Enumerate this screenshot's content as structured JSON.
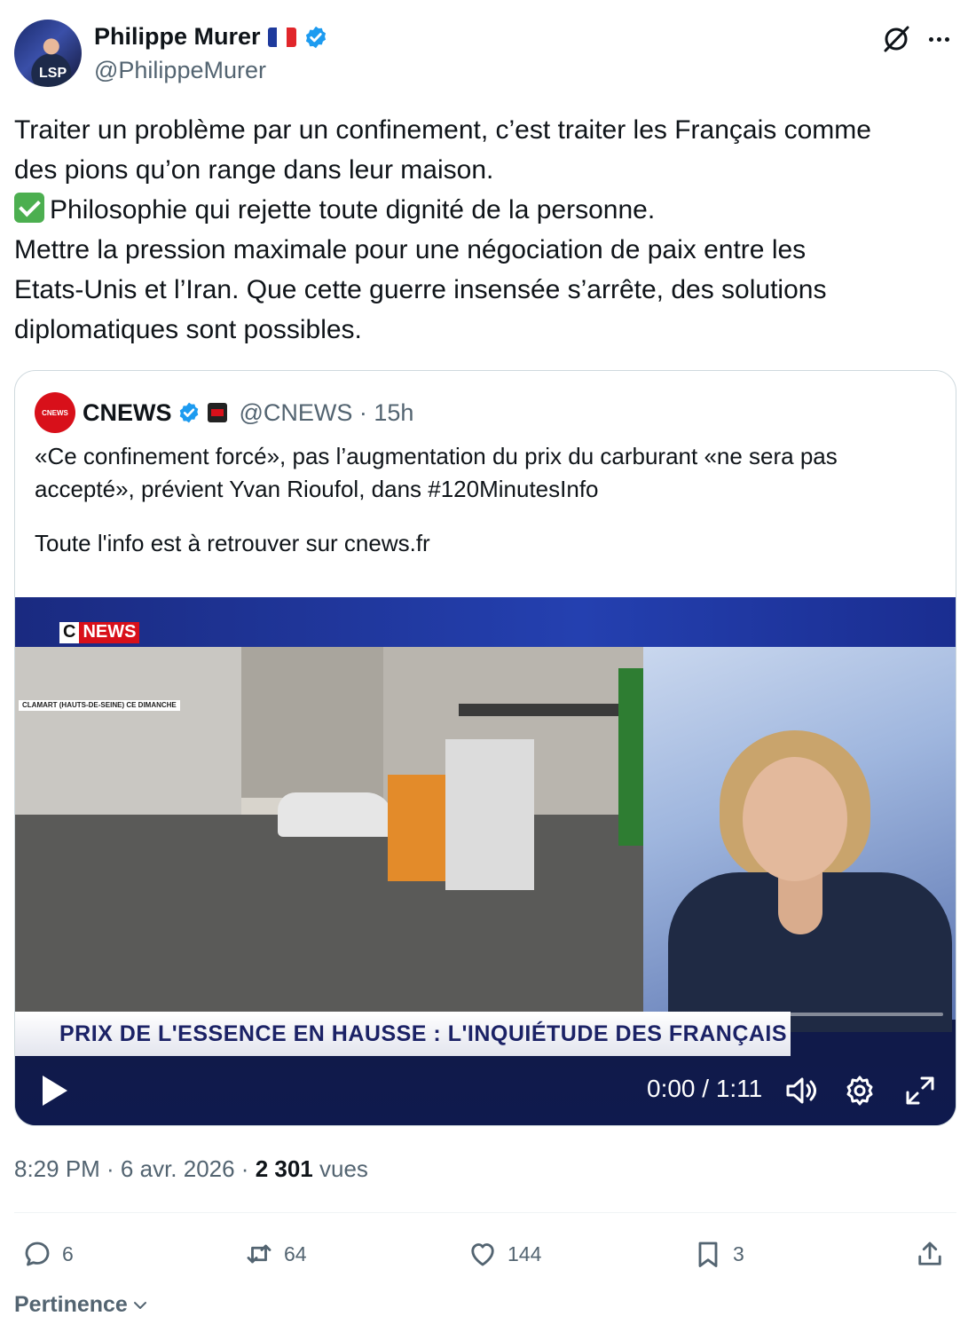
{
  "author": {
    "name": "Philippe Murer",
    "handle": "@PhilippeMurer",
    "avatar_mark": "LSP"
  },
  "tweet": {
    "lines": [
      "Traiter un problème par un confinement, c’est traiter les Français comme",
      "des pions qu’on range dans leur maison.",
      "Philosophie qui rejette toute dignité de la personne.",
      "Mettre la pression maximale pour une négociation de paix entre les",
      "Etats-Unis et l’Iran. Que cette guerre insensée s’arrête, des solutions",
      "diplomatiques sont possibles."
    ]
  },
  "quote": {
    "avatar_text": "CNEWS",
    "name": "CNEWS",
    "handle_time": "@CNEWS · 15h",
    "text_lines": [
      "«Ce confinement forcé», pas l’augmentation du prix du carburant «ne sera pas",
      "accepté», prévient Yvan Rioufol, dans #120MinutesInfo"
    ],
    "text_footer": "Toute l'info est à retrouver sur cnews.fr",
    "video": {
      "logo_c": "C",
      "logo_news": "NEWS",
      "location": "CLAMART (HAUTS-DE-SEINE) CE DIMANCHE",
      "banner": "PRIX DE L'ESSENCE EN HAUSSE : L'INQUIÉTUDE DES FRANÇAIS",
      "time": "0:00 / 1:11",
      "progress": 0
    }
  },
  "meta": {
    "time_date": "8:29 PM · 6 avr. 2026 · ",
    "views_count": "2 301",
    "views_label": " vues"
  },
  "actions": {
    "replies": "6",
    "reposts": "64",
    "likes": "144",
    "bookmarks": "3"
  },
  "sort": {
    "label": "Pertinence"
  },
  "colors": {
    "verified": "#1d9bf0",
    "text": "#0f1419",
    "secondary": "#536471",
    "cnews_red": "#d8101a"
  }
}
